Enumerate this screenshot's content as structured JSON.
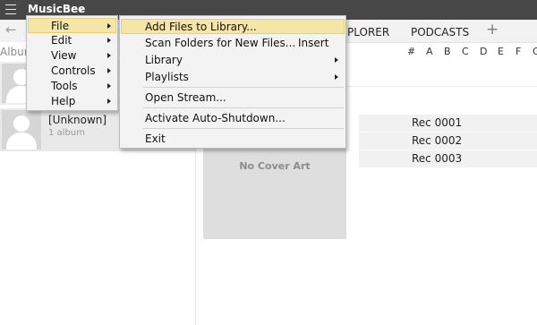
{
  "titlebar": {
    "app_name": "MusicBee"
  },
  "tabs": {
    "explorer_partial": "PLORER",
    "podcasts": "PODCASTS",
    "add": "+"
  },
  "left_panel": {
    "header": "Album",
    "artists": [
      {
        "name": "",
        "count": ""
      },
      {
        "name": "[Unknown]",
        "count": "1 album"
      }
    ]
  },
  "alphabet": [
    "#",
    "A",
    "B",
    "C",
    "D",
    "E",
    "F",
    "G"
  ],
  "cover": {
    "text": "No Cover Art"
  },
  "tracks": [
    "Rec 0001",
    "Rec 0002",
    "Rec 0003"
  ],
  "main_menu": {
    "items": [
      {
        "label": "File",
        "submenu": true,
        "highlighted": true
      },
      {
        "label": "Edit",
        "submenu": true
      },
      {
        "label": "View",
        "submenu": true
      },
      {
        "label": "Controls",
        "submenu": true
      },
      {
        "label": "Tools",
        "submenu": true
      },
      {
        "label": "Help",
        "submenu": true
      }
    ]
  },
  "file_menu": {
    "items": [
      {
        "label": "Add Files to Library...",
        "highlighted": true
      },
      {
        "label": "Scan Folders for New Files...",
        "shortcut": "Insert"
      },
      {
        "label": "Library",
        "submenu": true
      },
      {
        "label": "Playlists",
        "submenu": true
      },
      {
        "label": "Open Stream..."
      },
      {
        "label": "Activate Auto-Shutdown..."
      },
      {
        "label": "Exit"
      }
    ]
  },
  "colors": {
    "titlebar": "#474747",
    "menu_bg": "#f3f3f3",
    "menu_highlight": "#f5e6a8",
    "cover_bg": "#dedede"
  }
}
